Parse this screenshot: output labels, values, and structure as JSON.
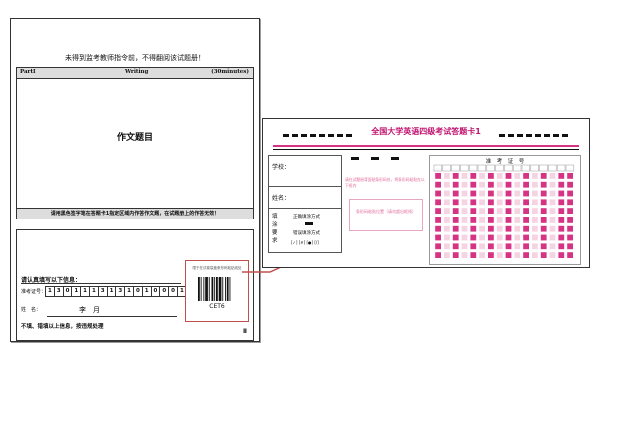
{
  "exam_sheet": {
    "notice": "未得到监考教师指令前，不得翻阅该试题册！",
    "writing_part": {
      "part_label": "PartI",
      "section_label": "Writing",
      "time_label": "(30minutes)",
      "essay_title": "作文题目",
      "instruction": "请用黑色签字笔在答题卡1指定区域内作答作文题，在试题册上的作答无效！"
    },
    "candidate_info": {
      "heading": "请认真填写以下信息：",
      "exam_number_label": "准考证号：",
      "exam_number_digits": [
        "1",
        "3",
        "0",
        "1",
        "1",
        "1",
        "3",
        "1",
        "3",
        "1",
        "0",
        "1",
        "0",
        "0",
        "0",
        "1"
      ],
      "name_label": "姓　名：",
      "name_value": "李　月",
      "warning": "不填、错填以上信息，按违规处理",
      "corner_mark": "Ⅱ"
    },
    "barcode_label": {
      "caption": "限于在试卷袋盖条形码粘贴线处",
      "code_text": "CET6"
    }
  },
  "answer_card": {
    "title": "全国大学英语四级考试答题卡1",
    "school_label": "学校：",
    "name_label": "姓名：",
    "fill_section_label": "填涂要求",
    "correct_fill_label": "正确填涂方式",
    "wrong_fill_label": "错误填涂方式",
    "wrong_fill_marks": "[✓] [✗] [●] [/]",
    "hint_text": "请在试题册背面贴条形码处，将条形码粘贴在以下框内",
    "barcode_slot_text": "条形码粘贴位置（请勿超出框线）",
    "exam_number_title": "准　考　证　号"
  },
  "colors": {
    "card_accent": "#d63384",
    "arrow": "#c0504d"
  }
}
